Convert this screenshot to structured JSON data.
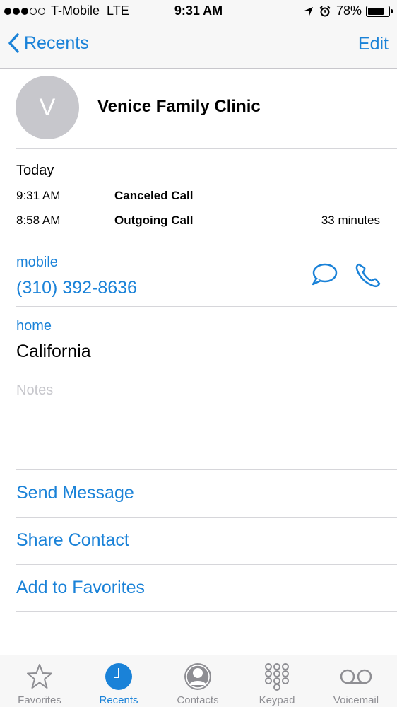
{
  "status_bar": {
    "carrier": "T-Mobile",
    "network": "LTE",
    "time": "9:31 AM",
    "battery": "78%",
    "battery_level": 0.78,
    "signal_bars": 3,
    "signal_total": 5
  },
  "nav": {
    "back_label": "Recents",
    "edit_label": "Edit"
  },
  "contact": {
    "initial": "V",
    "name": "Venice Family Clinic"
  },
  "history": {
    "date": "Today",
    "calls": [
      {
        "time": "9:31 AM",
        "type": "Canceled Call",
        "duration": ""
      },
      {
        "time": "8:58 AM",
        "type": "Outgoing Call",
        "duration": "33 minutes"
      }
    ]
  },
  "phone": {
    "label": "mobile",
    "number": "(310) 392-8636",
    "message_icon": "message-bubble-icon",
    "call_icon": "phone-handset-icon"
  },
  "address": {
    "label": "home",
    "value": "California"
  },
  "notes": {
    "placeholder": "Notes"
  },
  "actions": {
    "send_message": "Send Message",
    "share_contact": "Share Contact",
    "add_favorites": "Add to Favorites"
  },
  "tabs": [
    {
      "label": "Favorites",
      "icon": "star-icon",
      "active": false
    },
    {
      "label": "Recents",
      "icon": "clock-icon",
      "active": true
    },
    {
      "label": "Contacts",
      "icon": "person-icon",
      "active": false
    },
    {
      "label": "Keypad",
      "icon": "keypad-icon",
      "active": false
    },
    {
      "label": "Voicemail",
      "icon": "voicemail-icon",
      "active": false
    }
  ],
  "colors": {
    "accent": "#1a82d8",
    "avatar": "#c7c7cc",
    "inactive_tab": "#8e8e93"
  }
}
